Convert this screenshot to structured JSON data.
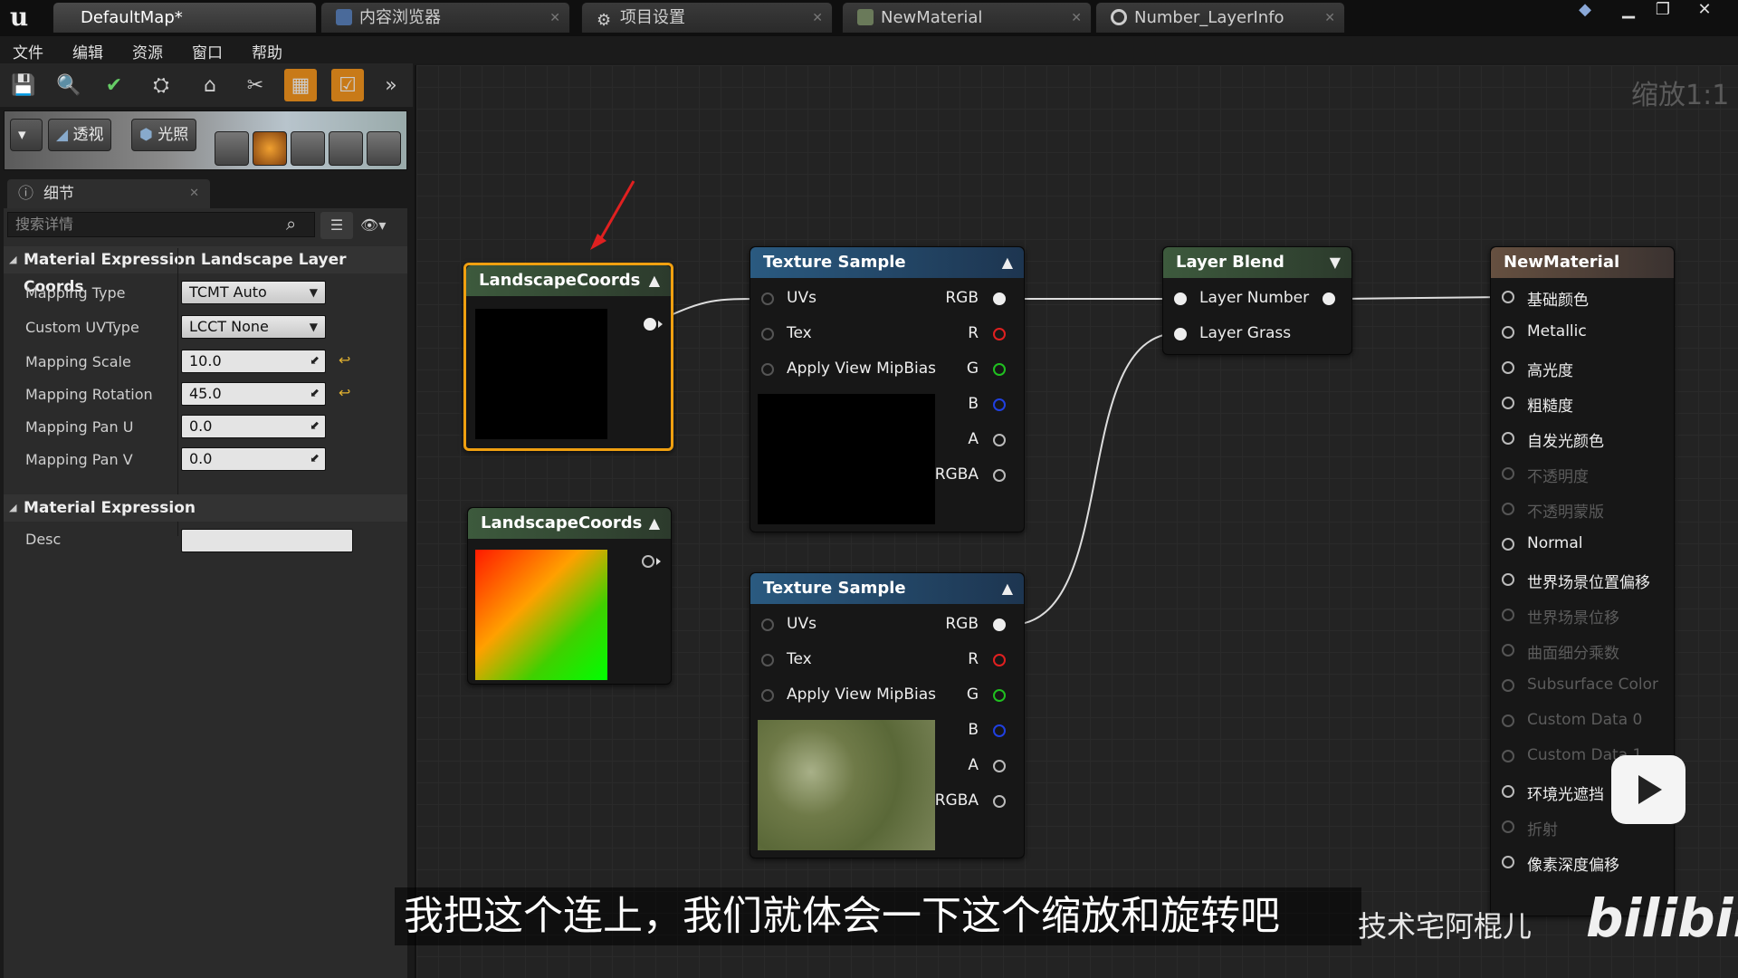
{
  "app": {
    "logo": "u"
  },
  "tabs": [
    {
      "label": "DefaultMap*",
      "icon": "level-icon"
    },
    {
      "label": "内容浏览器",
      "icon": "content-browser-icon"
    },
    {
      "label": "项目设置",
      "icon": "gear-icon"
    },
    {
      "label": "NewMaterial",
      "icon": "material-icon"
    },
    {
      "label": "Number_LayerInfo",
      "icon": "sphere-icon"
    }
  ],
  "menu": [
    "文件",
    "编辑",
    "资源",
    "窗口",
    "帮助"
  ],
  "viewport": {
    "perspective_label": "透视",
    "lit_label": "光照"
  },
  "details": {
    "tab_label": "细节",
    "search_placeholder": "搜索详情",
    "section1": {
      "title": "Material Expression Landscape Layer Coords",
      "props": [
        {
          "label": "Mapping Type",
          "value": "TCMT Auto"
        },
        {
          "label": "Custom UVType",
          "value": "LCCT None"
        },
        {
          "label": "Mapping Scale",
          "value": "10.0"
        },
        {
          "label": "Mapping Rotation",
          "value": "45.0"
        },
        {
          "label": "Mapping Pan U",
          "value": "0.0"
        },
        {
          "label": "Mapping Pan V",
          "value": "0.0"
        }
      ]
    },
    "section2": {
      "title": "Material Expression",
      "desc_label": "Desc",
      "desc_value": ""
    }
  },
  "graph": {
    "zoom": "缩放1:1",
    "nodes": {
      "coords1": {
        "title": "LandscapeCoords"
      },
      "coords2": {
        "title": "LandscapeCoords"
      },
      "tex1": {
        "title": "Texture Sample",
        "inputs": [
          "UVs",
          "Tex",
          "Apply View MipBias"
        ],
        "outputs": [
          "RGB",
          "R",
          "G",
          "B",
          "A",
          "RGBA"
        ]
      },
      "tex2": {
        "title": "Texture Sample",
        "inputs": [
          "UVs",
          "Tex",
          "Apply View MipBias"
        ],
        "outputs": [
          "RGB",
          "R",
          "G",
          "B",
          "A",
          "RGBA"
        ]
      },
      "blend": {
        "title": "Layer Blend",
        "pins": [
          "Layer Number",
          "Layer Grass"
        ]
      },
      "result": {
        "title": "NewMaterial",
        "pins": [
          {
            "label": "基础颜色",
            "enabled": true
          },
          {
            "label": "Metallic",
            "enabled": true
          },
          {
            "label": "高光度",
            "enabled": true
          },
          {
            "label": "粗糙度",
            "enabled": true
          },
          {
            "label": "自发光颜色",
            "enabled": true
          },
          {
            "label": "不透明度",
            "enabled": false
          },
          {
            "label": "不透明蒙版",
            "enabled": false
          },
          {
            "label": "Normal",
            "enabled": true
          },
          {
            "label": "世界场景位置偏移",
            "enabled": true
          },
          {
            "label": "世界场景位移",
            "enabled": false
          },
          {
            "label": "曲面细分乘数",
            "enabled": false
          },
          {
            "label": "Subsurface Color",
            "enabled": false
          },
          {
            "label": "Custom Data 0",
            "enabled": false
          },
          {
            "label": "Custom Data 1",
            "enabled": false
          },
          {
            "label": "环境光遮挡",
            "enabled": true
          },
          {
            "label": "折射",
            "enabled": false
          },
          {
            "label": "像素深度偏移",
            "enabled": true
          }
        ]
      }
    }
  },
  "overlay": {
    "subtitle": "我把这个连上，我们就体会一下这个缩放和旋转吧",
    "author": "技术宅阿棍儿",
    "platform": "bilibili"
  }
}
